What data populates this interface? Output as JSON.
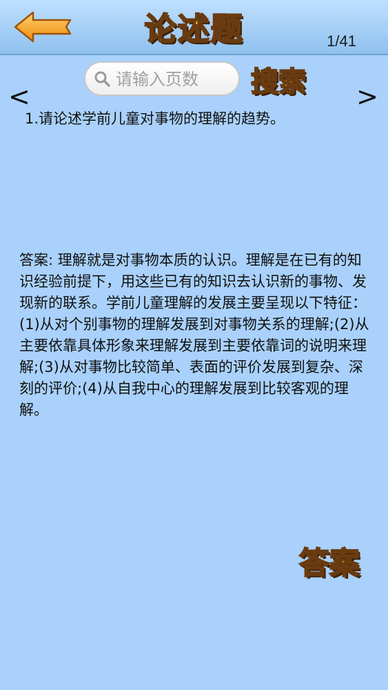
{
  "header": {
    "title": "论述题",
    "page_counter": "1/41"
  },
  "search": {
    "placeholder": "请输入页数",
    "button_label": "搜索"
  },
  "nav": {
    "prev_label": "<",
    "next_label": ">"
  },
  "question": {
    "text": "1.请论述学前儿童对事物的理解的趋势。"
  },
  "answer": {
    "text": "答案: 理解就是对事物本质的认识。理解是在已有的知识经验前提下，用这些已有的知识去认识新的事物、发现新的联系。学前儿童理解的发展主要呈现以下特征：(1)从对个别事物的理解发展到对事物关系的理解;(2)从主要依靠具体形象来理解发展到主要依靠词的说明来理解;(3)从对事物比较简单、表面的评价发展到复杂、深刻的评价;(4)从自我中心的理解发展到比较客观的理解。",
    "button_label": "答案"
  },
  "icons": {
    "back": "back-arrow-icon",
    "search": "search-icon"
  },
  "colors": {
    "background": "#a9d1fb",
    "title_fill": "#f6c020",
    "title_outline": "#6a3b10",
    "back_arrow": "#f39a1e"
  }
}
